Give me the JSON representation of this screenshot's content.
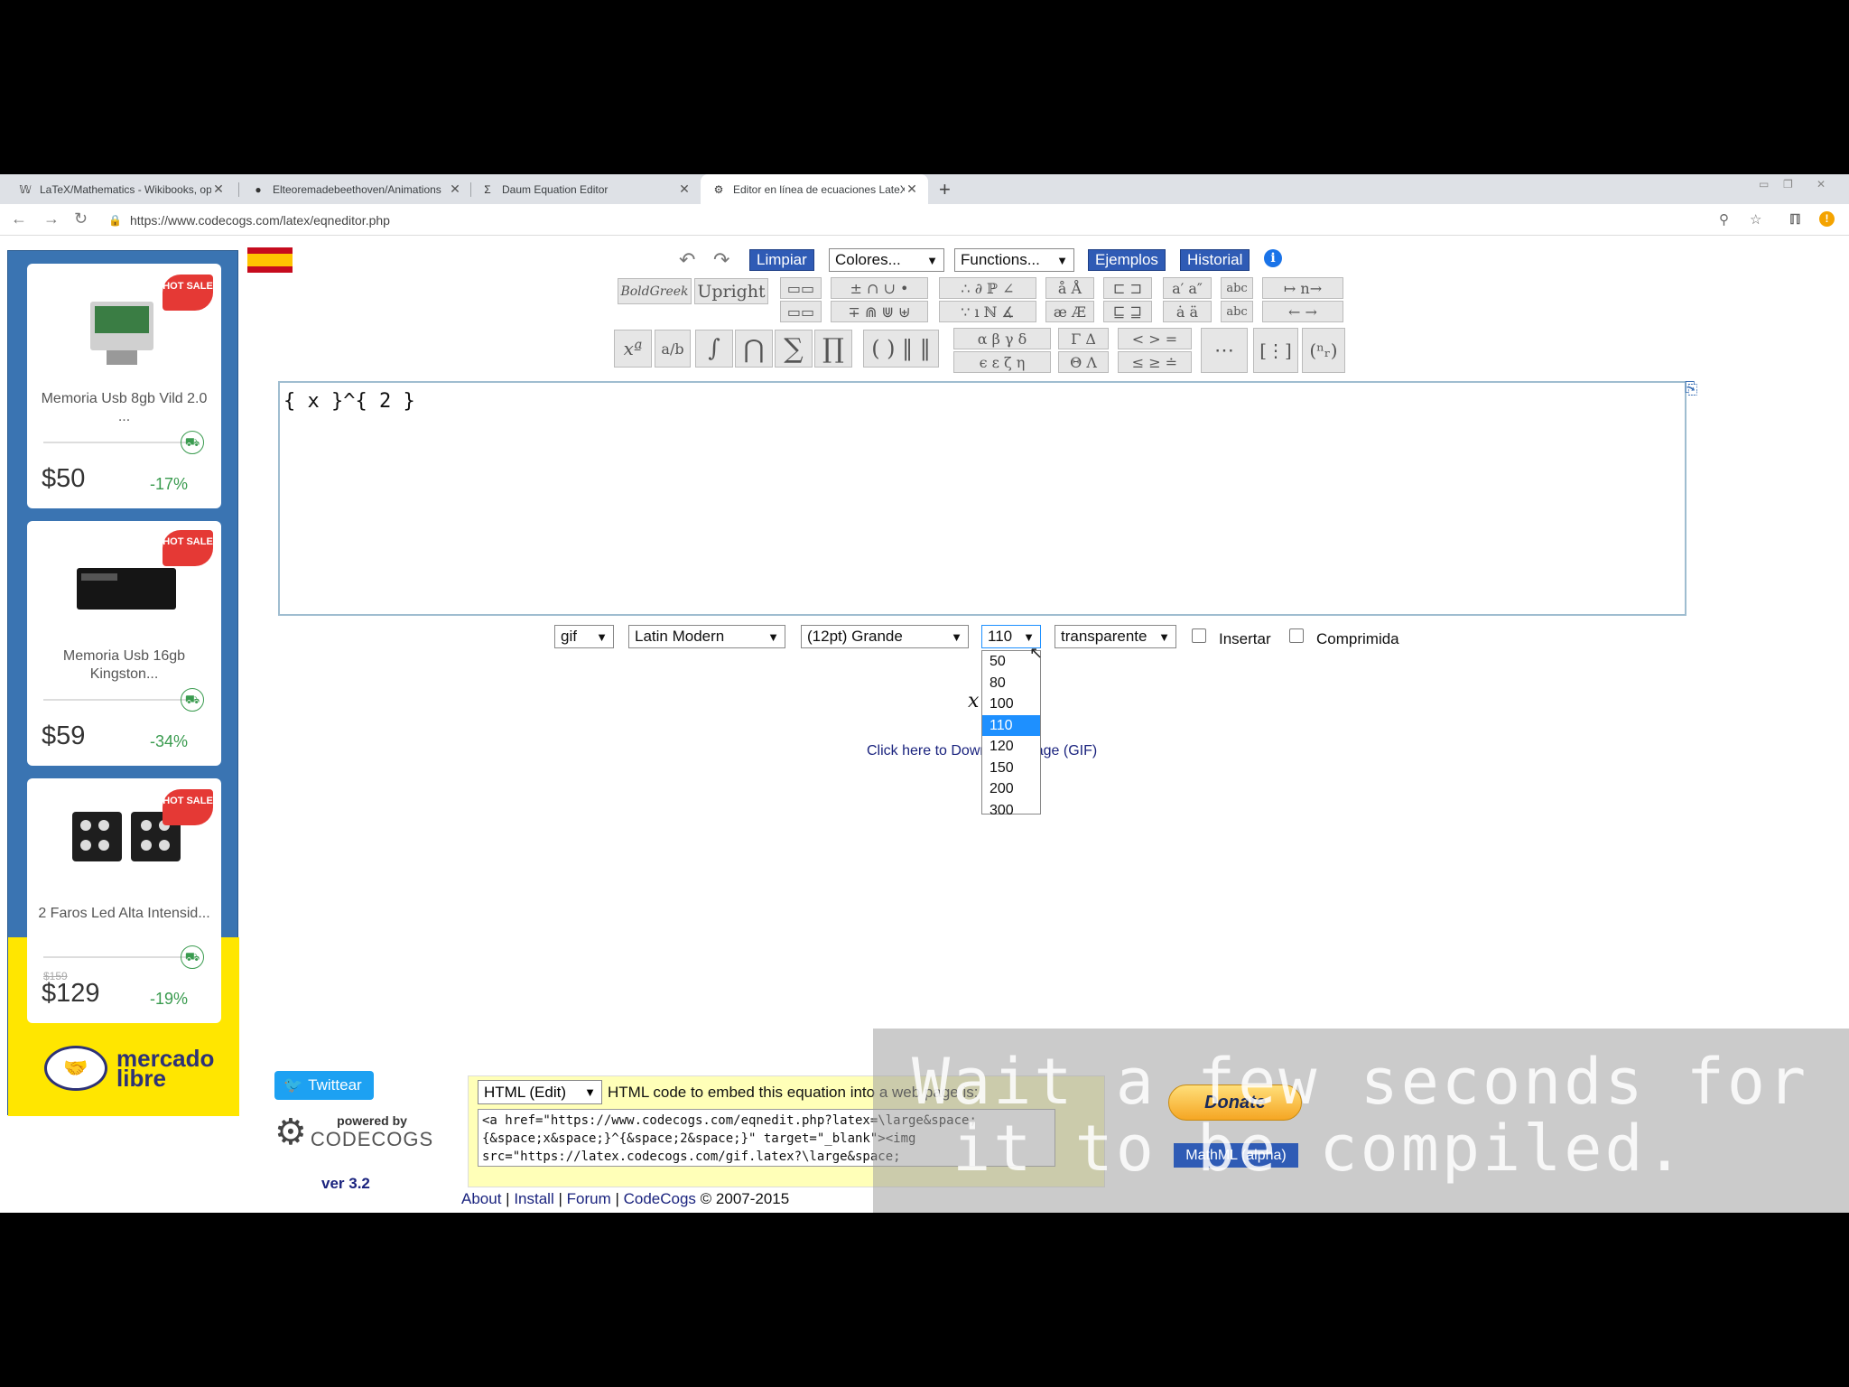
{
  "browser": {
    "tabs": [
      {
        "title": "LaTeX/Mathematics - Wikibooks, op",
        "icon": "wikibooks-icon"
      },
      {
        "title": "Elteoremadebeethoven/Animations",
        "icon": "github-icon"
      },
      {
        "title": "Daum Equation Editor",
        "icon": "daum-icon"
      },
      {
        "title": "Editor en línea de ecuaciones LateX",
        "icon": "gear-icon"
      }
    ],
    "url": "https://www.codecogs.com/latex/eqneditor.php"
  },
  "ads": {
    "items": [
      {
        "name": "Memoria Usb 8gb Vild 2.0 ...",
        "price": "$50",
        "discount": "-17%",
        "badge": "HOT SALE",
        "old_price": ""
      },
      {
        "name": "Memoria Usb 16gb Kingston...",
        "price": "$59",
        "discount": "-34%",
        "badge": "HOT SALE",
        "old_price": ""
      },
      {
        "name": "2 Faros Led Alta Intensid...",
        "price": "$129",
        "discount": "-19%",
        "badge": "HOT SALE",
        "old_price": "$159"
      }
    ],
    "brand_line1": "mercado",
    "brand_line2": "libre"
  },
  "toolbar": {
    "clear": "Limpiar",
    "colors": "Colores...",
    "functions": "Functions...",
    "examples": "Ejemplos",
    "history": "Historial",
    "boldgreek": "BoldGreek",
    "upright": "Upright"
  },
  "editor": {
    "content": "{ x }^{ 2 }"
  },
  "options": {
    "format": "gif",
    "font": "Latin Modern",
    "size": "(12pt) Grande",
    "dpi": "110",
    "background": "transparente",
    "insert_label": "Insertar",
    "compressed_label": "Comprimida"
  },
  "dpi_dropdown": {
    "options": [
      "50",
      "80",
      "100",
      "110",
      "120",
      "150",
      "200",
      "300"
    ],
    "selected": "110"
  },
  "preview": {
    "glyph": "x",
    "download_link": "Click here to Download Image (GIF)"
  },
  "embed": {
    "mode": "HTML (Edit)",
    "label": "HTML code to embed this equation into a web page is:",
    "code": "<a href=\"https://www.codecogs.com/eqnedit.php?latex=\\large&space;\n{&space;x&space;}^{&space;2&space;}\" target=\"_blank\"><img\nsrc=\"https://latex.codecogs.com/gif.latex?\\large&space;"
  },
  "side": {
    "tweet": "Twittear",
    "powered_by": "powered by",
    "brand": "CODECOGS",
    "version": "ver 3.2"
  },
  "footer": {
    "about": "About",
    "install": "Install",
    "forum": "Forum",
    "codecogs": "CodeCogs",
    "copyright": "© 2007-2015"
  },
  "buttons": {
    "donate": "Donate",
    "mathml": "MathML (alpha)"
  },
  "overlay_text": "Wait a few seconds for\n it to be compiled."
}
